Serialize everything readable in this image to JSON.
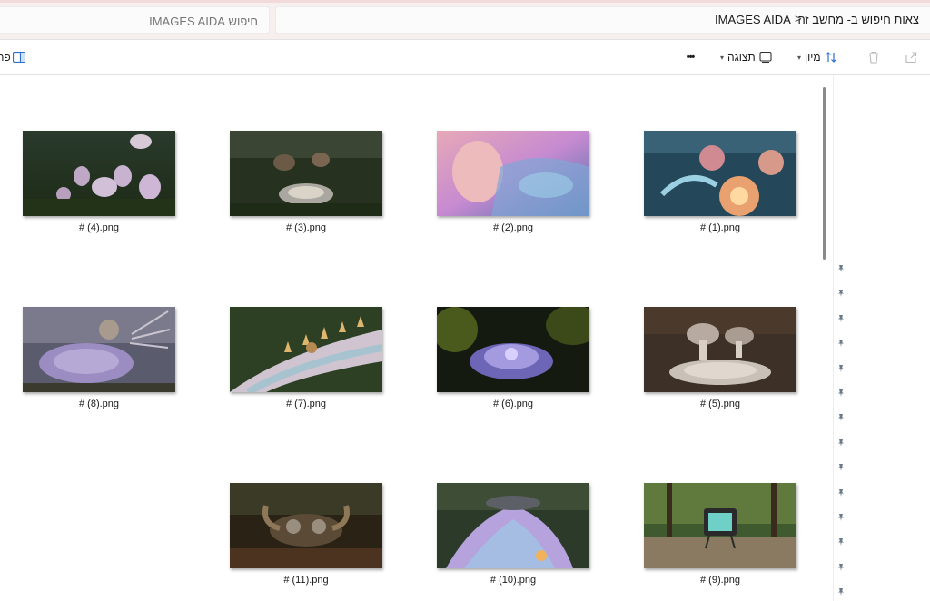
{
  "address_bar": {
    "search_placeholder": "חיפוש IMAGES AIDA",
    "breadcrumb_current": "IMAGES AIDA",
    "breadcrumb_location": "צאות חיפוש ב- מחשב זה",
    "separator": ">"
  },
  "command_bar": {
    "sort_label": "מיון",
    "view_label": "תצוגה",
    "more_label": "•••",
    "details_label": "פר"
  },
  "files": [
    {
      "name": "# (1).png",
      "icon": "image-thumbnail"
    },
    {
      "name": "# (2).png",
      "icon": "image-thumbnail"
    },
    {
      "name": "# (3).png",
      "icon": "image-thumbnail"
    },
    {
      "name": "# (4).png",
      "icon": "image-thumbnail"
    },
    {
      "name": "# (5).png",
      "icon": "image-thumbnail"
    },
    {
      "name": "# (6).png",
      "icon": "image-thumbnail"
    },
    {
      "name": "# (7).png",
      "icon": "image-thumbnail"
    },
    {
      "name": "# (8).png",
      "icon": "image-thumbnail"
    },
    {
      "name": "# (9).png",
      "icon": "image-thumbnail"
    },
    {
      "name": "# (10).png",
      "icon": "image-thumbnail"
    },
    {
      "name": "# (11).png",
      "icon": "image-thumbnail"
    }
  ],
  "nav_pane": {
    "pinned_count": 14,
    "pin_icon": "pin-icon"
  },
  "colors": {
    "titlebar_bg": "#f7eeee",
    "sort_icon": "#2f6fd0",
    "text": "#1a1a1a"
  }
}
